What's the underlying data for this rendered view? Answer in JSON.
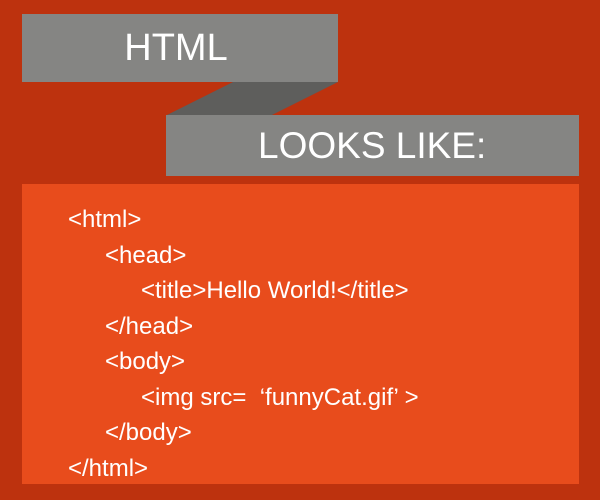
{
  "header": {
    "title": "HTML",
    "subtitle": "LOOKS LIKE:"
  },
  "colors": {
    "background": "#bd320e",
    "banner": "#858583",
    "banner_fold": "#5e5e5c",
    "code_panel": "#e84c1c",
    "text": "#ffffff"
  },
  "code": {
    "lines": [
      {
        "text": "<html>",
        "indent": 0
      },
      {
        "text": "<head>",
        "indent": 1
      },
      {
        "text": "<title>Hello World!</title>",
        "indent": 2
      },
      {
        "text": "</head>",
        "indent": 1
      },
      {
        "text": "<body>",
        "indent": 1
      },
      {
        "text": "<img src=  ‘funnyCat.gif’ >",
        "indent": 2
      },
      {
        "text": "</body>",
        "indent": 1
      },
      {
        "text": "</html>",
        "indent": 0
      }
    ]
  }
}
